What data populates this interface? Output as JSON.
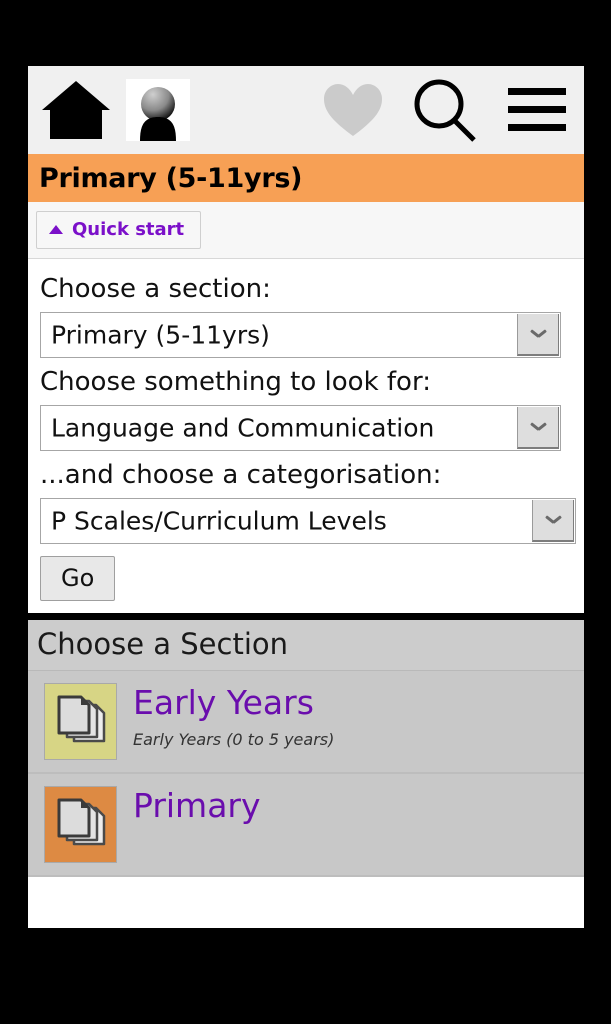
{
  "appbar": {
    "home_icon": "home-icon",
    "avatar_icon": "user-avatar-icon",
    "favourites_icon": "heart-icon",
    "search_icon": "search-icon",
    "menu_icon": "hamburger-menu-icon"
  },
  "titlebar": {
    "title": "Primary (5-11yrs)",
    "background": "#f7a055"
  },
  "quickstart": {
    "label": "Quick start",
    "toggle_icon": "triangle-up-icon",
    "accent": "#7b10c9",
    "expanded": true
  },
  "form": {
    "section_label": "Choose a section:",
    "section_value": "Primary (5-11yrs)",
    "lookfor_label": "Choose something to look for:",
    "lookfor_value": "Language and Communication",
    "categorisation_label": "...and choose a categorisation:",
    "categorisation_value": "P Scales/Curriculum Levels",
    "submit_label": "Go",
    "dropdown_icon": "chevron-down-icon"
  },
  "sections": {
    "heading": "Choose a Section",
    "items": [
      {
        "title": "Early Years",
        "subtitle": "Early Years (0 to 5 years)",
        "icon": "stacked-pages-icon",
        "icon_color": "#d7d585"
      },
      {
        "title": "Primary",
        "subtitle": "",
        "icon": "stacked-pages-icon",
        "icon_color": "#dd8a43"
      }
    ],
    "link_color": "#6a0dad",
    "background": "#cccccc"
  }
}
